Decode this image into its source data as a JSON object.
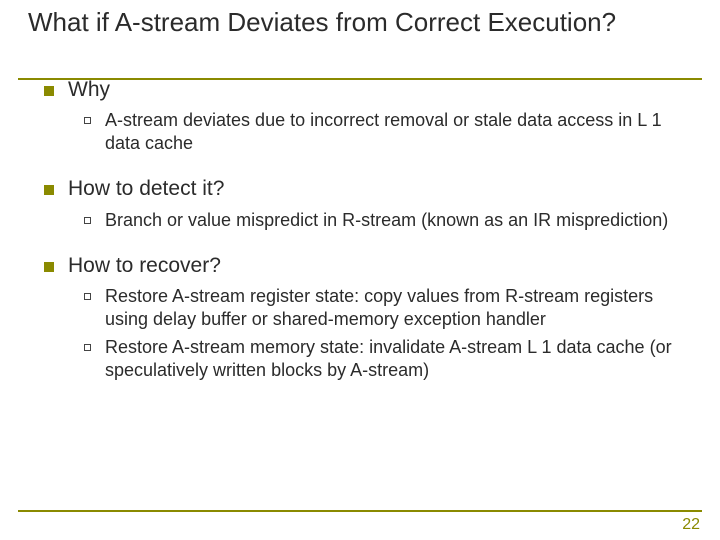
{
  "title": "What if A-stream Deviates from Correct Execution?",
  "sections": [
    {
      "heading": "Why",
      "items": [
        "A-stream deviates due to incorrect removal or stale data access in L 1 data cache"
      ]
    },
    {
      "heading": "How to detect it?",
      "items": [
        "Branch or value mispredict in R-stream (known as an IR misprediction)"
      ]
    },
    {
      "heading": "How to recover?",
      "items": [
        "Restore A-stream register state: copy values from R-stream registers using delay buffer or shared-memory exception handler",
        "Restore A-stream memory state: invalidate A-stream L 1 data cache (or speculatively written blocks by A-stream)"
      ]
    }
  ],
  "page_number": "22"
}
